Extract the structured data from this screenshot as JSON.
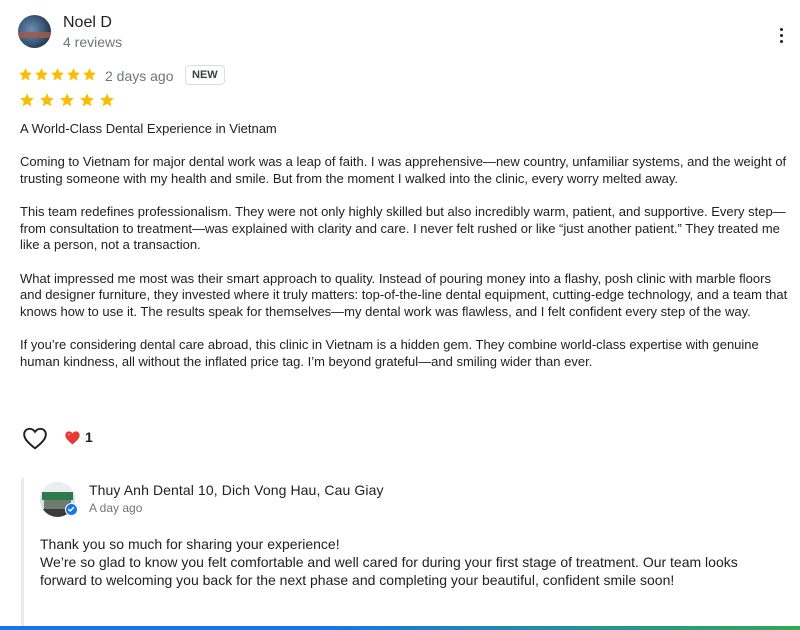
{
  "reviewer": {
    "name": "Noel D",
    "meta": "4 reviews"
  },
  "review": {
    "rating": 5,
    "time": "2 days ago",
    "badge": "NEW",
    "second_rating": 5,
    "title": "A World-Class Dental Experience in Vietnam",
    "paragraphs": [
      "Coming to Vietnam for major dental work was a leap of faith. I was apprehensive—new country, unfamiliar systems, and the weight of trusting someone with my health and smile. But from the moment I walked into the clinic, every worry melted away.",
      "This team redefines professionalism. They were not only highly skilled but also incredibly warm, patient, and supportive. Every step—from consultation to treatment—was explained with clarity and care. I never felt rushed or like “just another patient.” They treated me like a person, not a transaction.",
      "What impressed me most was their smart approach to quality. Instead of pouring money into a flashy, posh clinic with marble floors and designer furniture, they invested where it truly matters: top-of-the-line dental equipment, cutting-edge technology, and a team that knows how to use it. The results speak for themselves—my dental work was flawless, and I felt confident every step of the way.",
      "If you’re considering dental care abroad, this clinic in Vietnam is a hidden gem. They combine world-class expertise with genuine human kindness, all without the inflated price tag. I’m beyond grateful—and smiling wider than ever."
    ]
  },
  "reactions": {
    "like_icon": "heart-outline-icon",
    "heart_icon": "red-heart-icon",
    "heart_count": "1"
  },
  "reply": {
    "owner_name": "Thuy Anh Dental 10, Dich Vong Hau, Cau Giay",
    "time": "A day ago",
    "lines": [
      "Thank you so much for sharing your experience!",
      "We’re so glad to know you felt comfortable and well cared for during your first stage of treatment. Our team looks forward to welcoming you back for the next phase and completing your beautiful, confident smile soon!"
    ]
  },
  "colors": {
    "star": "#fbbc04",
    "heart": "#e53935",
    "verified": "#1a73e8",
    "muted_text": "#70757a"
  }
}
